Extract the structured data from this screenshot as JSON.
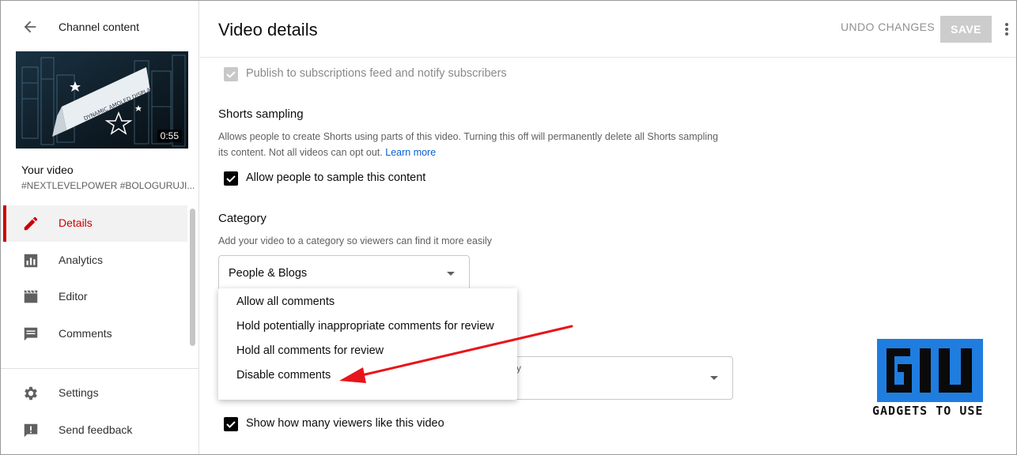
{
  "sidebar": {
    "title": "Channel content",
    "video_duration": "0:55",
    "your_video_label": "Your video",
    "video_tags": "#NEXTLEVELPOWER #BOLOGURUJI...",
    "thumbnail_text": "DYNAMIC AMOLED DISPLAY",
    "nav": [
      {
        "label": "Details",
        "icon": "pencil-icon",
        "active": true
      },
      {
        "label": "Analytics",
        "icon": "analytics-icon"
      },
      {
        "label": "Editor",
        "icon": "clapperboard-icon"
      },
      {
        "label": "Comments",
        "icon": "comment-icon"
      },
      {
        "label": "Settings",
        "icon": "gear-icon"
      },
      {
        "label": "Send feedback",
        "icon": "feedback-icon"
      }
    ]
  },
  "header": {
    "title": "Video details",
    "undo_label": "UNDO CHANGES",
    "save_label": "SAVE"
  },
  "main": {
    "publish_feed_label": "Publish to subscriptions feed and notify subscribers",
    "shorts": {
      "title": "Shorts sampling",
      "desc_line1": "Allows people to create Shorts using parts of this video. Turning this off will permanently delete all Shorts sampling",
      "desc_line2": "its content. Not all videos can opt out.",
      "learn_more": "Learn more",
      "checkbox_label": "Allow people to sample this content"
    },
    "category": {
      "title": "Category",
      "desc": "Add your video to a category so viewers can find it more easily",
      "selected": "People & Blogs"
    },
    "comments_dropdown": {
      "options": [
        "Allow all comments",
        "Hold potentially inappropriate comments for review",
        "Hold all comments for review",
        "Disable comments"
      ],
      "partial_label": "y"
    },
    "likes_label": "Show how many viewers like this video"
  },
  "watermark": {
    "text": "GADGETS TO USE"
  },
  "colors": {
    "accent_red": "#cc0000",
    "arrow_red": "#e8141b",
    "link_blue": "#065fd4",
    "logo_blue": "#1f7de0"
  }
}
